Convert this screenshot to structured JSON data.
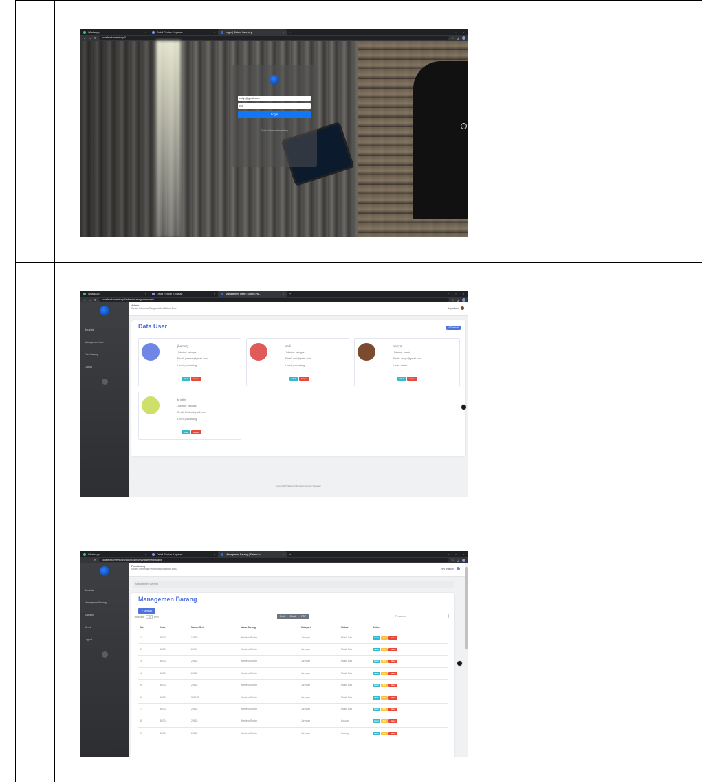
{
  "screenshot1": {
    "tabs": [
      {
        "title": "WhatsApp"
      },
      {
        "title": "Detail Rincian Kegiatan"
      },
      {
        "title": "Login | Sistem Inventory"
      }
    ],
    "url": "localhost/inventoryIl/",
    "email_value": "cahyo@gmail.com",
    "password_value": "••••",
    "login_label": "Login",
    "card_caption": "Sistem Informasi Inventory"
  },
  "screenshot2": {
    "tabs": [
      {
        "title": "WhatsApp"
      },
      {
        "title": "Detail Rincian Kegiatan"
      },
      {
        "title": "Managemen User | Sistem Inv..."
      }
    ],
    "url": "localhost/inventoryIl/admin/managemenuser/",
    "role": "Admin",
    "subtitle": "Sistem Informasi Pengendalian Bahan Baku",
    "greeting": "Hey admin",
    "sidebar": [
      "Beranda",
      "Managemen User",
      "Data Barang",
      "Logout"
    ],
    "page_title": "Data User",
    "add_label": "+ Tambah",
    "edit_label": "Ubah",
    "delete_label": "Hapus",
    "users": [
      {
        "name": "jhamary",
        "jabatan": "Jabatan: petugas",
        "email": "Email: jhamary@gmail.com",
        "level": "Level: purchasing",
        "color": "#6f86e6"
      },
      {
        "name": "ardi",
        "jabatan": "Jabatan: petugas",
        "email": "Email: ardi@gmail.com",
        "level": "Level: purchasing",
        "color": "#e05a5a"
      },
      {
        "name": "cahyo",
        "jabatan": "Jabatan: admin",
        "email": "Email: cahyo@gmail.com",
        "level": "Level: admin",
        "color": "#7a4b2e"
      },
      {
        "name": "khoilis",
        "jabatan": "Jabatan: petugas",
        "email": "Email: khoilis@gmail.com",
        "level": "Level: purchasing",
        "color": "#cfe06a"
      }
    ],
    "footer": "Copyright © Sistem Informasi Inventory Koperasi"
  },
  "screenshot3": {
    "tabs": [
      {
        "title": "WhatsApp"
      },
      {
        "title": "Detail Rincian Kegiatan"
      },
      {
        "title": "Managemen Barang | Sistem In..."
      }
    ],
    "url": "localhost/inventoryIl/purchasing/managemenbarang",
    "role": "Purchasing",
    "subtitle": "Sistem Informasi Pengendalian Bahan Baku",
    "greeting": "Hey Jhamary",
    "sidebar": [
      "Beranda",
      "Managemen Barang",
      "Kategori",
      "Merek",
      "Logout"
    ],
    "breadcrumb": "Managemen Barang",
    "page_title": "Managemen Barang",
    "add_label": "+ Tambah",
    "show_label": "Tampilkan",
    "show_value": "10",
    "entries_label": "entri",
    "export_buttons": [
      "Print",
      "Excel",
      "PDF"
    ],
    "search_label": "Pencarian:",
    "columns": [
      "No",
      "Kode",
      "Nomor Seri",
      "Nama Barang",
      "Kategori",
      "Status",
      "Action"
    ],
    "actions": [
      "Detail",
      "Ubah",
      "Hapus"
    ],
    "rows": [
      [
        "1",
        "BR001",
        "14879",
        "Wireless Router",
        "Jaringan",
        "Masih Ada"
      ],
      [
        "2",
        "BR001",
        "2548",
        "Wireless Router",
        "Jaringan",
        "Masih Ada"
      ],
      [
        "3",
        "BR001",
        "25632",
        "Wireless Router",
        "Jaringan",
        "Masih Ada"
      ],
      [
        "4",
        "BR001",
        "25632",
        "Wireless Router",
        "Jaringan",
        "Masih Ada"
      ],
      [
        "5",
        "BR001",
        "25632",
        "Wireless Router",
        "Jaringan",
        "Masih Ada"
      ],
      [
        "6",
        "BR001",
        "365478",
        "Wireless Router",
        "Jaringan",
        "Masih Ada"
      ],
      [
        "7",
        "BR001",
        "25632",
        "Wireless Router",
        "Jaringan",
        "Masih Ada"
      ],
      [
        "8",
        "BR001",
        "25632",
        "Wireless Router",
        "Jaringan",
        "Kosong"
      ],
      [
        "9",
        "BR001",
        "25632",
        "Wireless Router",
        "Jaringan",
        "Kosong"
      ]
    ]
  }
}
